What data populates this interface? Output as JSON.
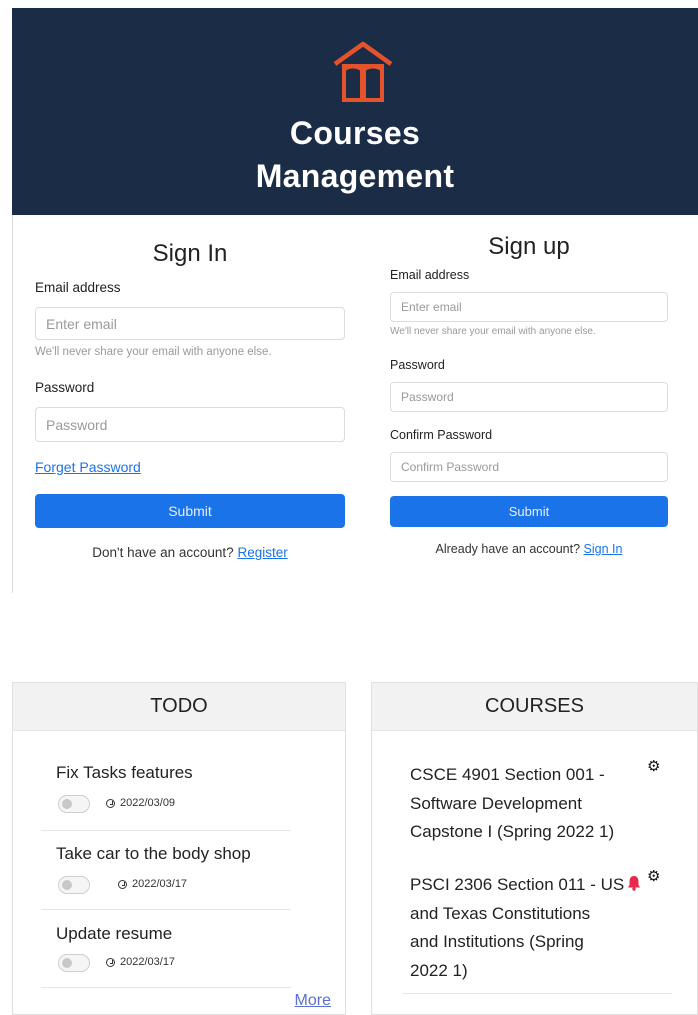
{
  "brand": {
    "line1": "Courses",
    "line2": "Management",
    "accent_color": "#e5532d",
    "bg_color": "#1b2d46",
    "icon": "book-house-icon"
  },
  "signin": {
    "title": "Sign In",
    "email_label": "Email address",
    "email_placeholder": "Enter email",
    "email_help": "We'll never share your email with anyone else.",
    "password_label": "Password",
    "password_placeholder": "Password",
    "forget_link": "Forget Password",
    "submit_label": "Submit",
    "footer_text": "Don't have an account?",
    "footer_link": "Register"
  },
  "signup": {
    "title": "Sign up",
    "email_label": "Email address",
    "email_placeholder": "Enter email",
    "email_help": "We'll never share your email with anyone else.",
    "password_label": "Password",
    "password_placeholder": "Password",
    "confirm_label": "Confirm Password",
    "confirm_placeholder": "Confirm Password",
    "submit_label": "Submit",
    "footer_text": "Already have an account?",
    "footer_link": "Sign In"
  },
  "todo": {
    "title": "TODO",
    "items": [
      {
        "text": "Fix Tasks features",
        "date": "2022/03/09"
      },
      {
        "text": "Take car to the body shop",
        "date": "2022/03/17"
      },
      {
        "text": "Update resume",
        "date": "2022/03/17"
      }
    ],
    "more_label": "More"
  },
  "courses": {
    "title": "COURSES",
    "items": [
      {
        "lines": [
          "CSCE 4901 Section 001 -",
          "Software Development",
          "Capstone I (Spring 2022 1)"
        ]
      },
      {
        "lines": [
          "PSCI 2306 Section 011 - US",
          "and Texas Constitutions",
          "and Institutions (Spring",
          "2022 1)"
        ]
      }
    ]
  },
  "colors": {
    "primary": "#1a73e8",
    "bell": "#e8294b"
  }
}
